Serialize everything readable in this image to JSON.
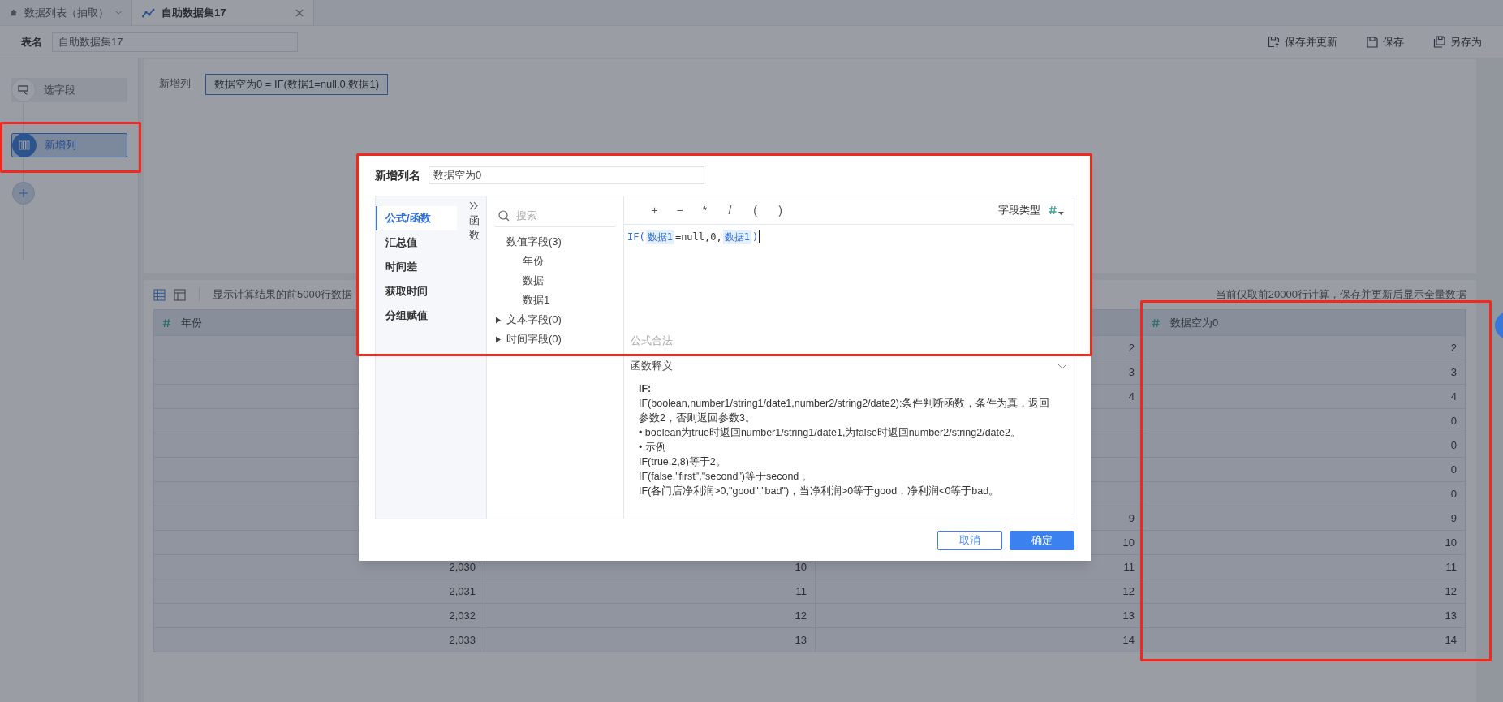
{
  "tabs": [
    {
      "label": "数据列表（抽取）",
      "selected": false,
      "kind": "list"
    },
    {
      "label": "自助数据集17",
      "selected": true,
      "kind": "dataset"
    }
  ],
  "toolbar": {
    "name_label": "表名",
    "name_value": "自助数据集17",
    "actions": [
      {
        "label": "保存并更新",
        "kind": "save-update"
      },
      {
        "label": "保存",
        "kind": "save"
      },
      {
        "label": "另存为",
        "kind": "save-as"
      }
    ]
  },
  "steps": [
    {
      "label": "选字段",
      "selected": false,
      "kind": "select"
    },
    {
      "label": "新增列",
      "selected": true,
      "kind": "column"
    }
  ],
  "formula_panel": {
    "label": "新增列",
    "formula": "数据空为0 = IF(数据1=null,0,数据1)"
  },
  "table": {
    "info": "显示计算结果的前5000行数据",
    "note": "当前仅取前20000行计算，保存并更新后显示全量数据",
    "columns": [
      "年份",
      null,
      null,
      "数据空为0"
    ],
    "rows": [
      [
        null,
        null,
        "2",
        "2"
      ],
      [
        null,
        null,
        "3",
        "3"
      ],
      [
        null,
        null,
        "4",
        "4"
      ],
      [
        null,
        null,
        null,
        "0"
      ],
      [
        null,
        null,
        null,
        "0"
      ],
      [
        null,
        null,
        null,
        "0"
      ],
      [
        null,
        null,
        null,
        "0"
      ],
      [
        null,
        null,
        "9",
        "9"
      ],
      [
        null,
        null,
        "10",
        "10"
      ],
      [
        "2,030",
        "10",
        "11",
        "11"
      ],
      [
        "2,031",
        "11",
        "12",
        "12"
      ],
      [
        "2,032",
        "12",
        "13",
        "13"
      ],
      [
        "2,033",
        "13",
        "14",
        "14"
      ]
    ]
  },
  "dialog": {
    "name_label": "新增列名",
    "name_value": "数据空为0",
    "categories": [
      {
        "label": "公式/函数",
        "selected": true
      },
      {
        "label": "汇总值",
        "selected": false
      },
      {
        "label": "时间差",
        "selected": false
      },
      {
        "label": "获取时间",
        "selected": false
      },
      {
        "label": "分组赋值",
        "selected": false
      }
    ],
    "collapse_label": "函数",
    "search_placeholder": "搜索",
    "field_groups": [
      {
        "label": "数值字段(3)",
        "expanded": true,
        "children": [
          {
            "label": "年份"
          },
          {
            "label": "数据"
          },
          {
            "label": "数据1"
          }
        ]
      },
      {
        "label": "文本字段(0)",
        "expanded": false
      },
      {
        "label": "时间字段(0)",
        "expanded": false
      }
    ],
    "operators": [
      "+",
      "−",
      "*",
      "/",
      "(",
      ")"
    ],
    "field_type_label": "字段类型",
    "formula_tokens": [
      {
        "kind": "func",
        "text": "IF("
      },
      {
        "kind": "field",
        "text": "数据1"
      },
      {
        "kind": "plain",
        "text": "=null,0,"
      },
      {
        "kind": "field",
        "text": "数据1"
      },
      {
        "kind": "func",
        "text": ")"
      }
    ],
    "status": "公式合法",
    "help_title": "函数释义",
    "help_expanded": true,
    "help_lines": [
      {
        "text": "IF:",
        "bold": true
      },
      {
        "text": "IF(boolean,number1/string1/date1,number2/string2/date2):条件判断函数，条件为真，返回参数2，否则返回参数3。",
        "bold": false
      },
      {
        "text": "• boolean为true时返回number1/string1/date1,为false时返回number2/string2/date2。",
        "bold": false
      },
      {
        "text": "• 示例",
        "bold": false
      },
      {
        "text": "IF(true,2,8)等于2。",
        "bold": false
      },
      {
        "text": "IF(false,\"first\",\"second\")等于second 。",
        "bold": false
      },
      {
        "text": "IF(各门店净利润>0,\"good\",\"bad\")，当净利润>0等于good，净利润<0等于bad。",
        "bold": false
      }
    ],
    "buttons": [
      {
        "label": "取消",
        "kind": "secondary"
      },
      {
        "label": "确定",
        "kind": "primary"
      }
    ]
  }
}
